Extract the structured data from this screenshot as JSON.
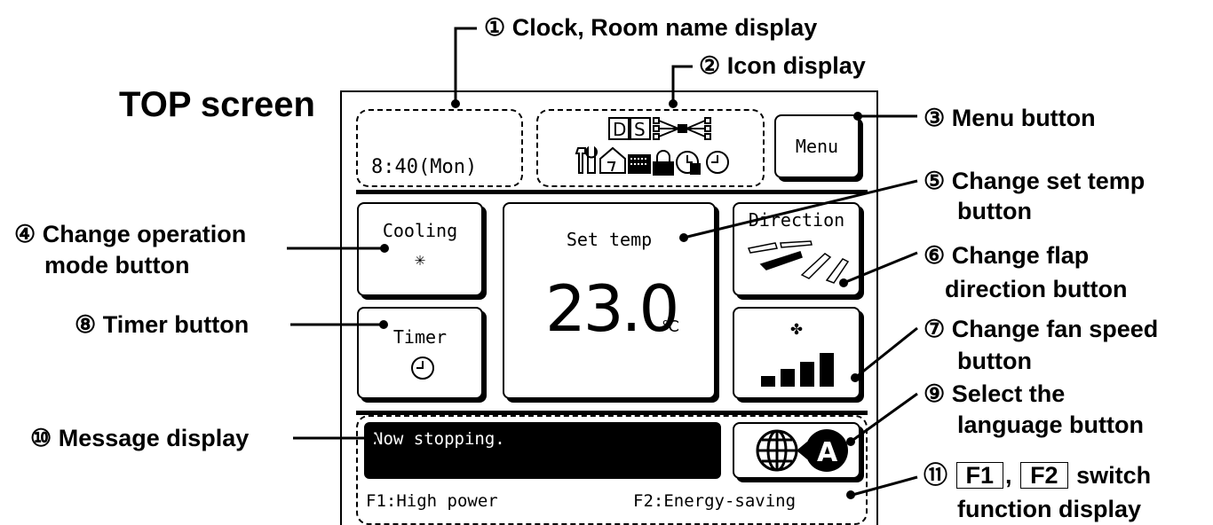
{
  "title": "TOP screen",
  "callouts": {
    "c1": "① Clock, Room name display",
    "c2": "② Icon display",
    "c3": "③ Menu button",
    "c4_l1": "④ Change operation",
    "c4_l2": "mode button",
    "c5_l1": "⑤ Change set temp",
    "c5_l2": "button",
    "c6_l1": "⑥ Change flap",
    "c6_l2": "direction button",
    "c7_l1": "⑦ Change fan speed",
    "c7_l2": "button",
    "c8": "⑧ Timer button",
    "c9_l1": "⑨ Select the",
    "c9_l2": "language button",
    "c10": "⑩ Message display",
    "c11_num": "⑪",
    "c11_f1": "F1",
    "c11_comma": ",",
    "c11_f2": "F2",
    "c11_rest": "switch",
    "c11_l2": "function display"
  },
  "screen": {
    "clock": "8:40(Mon)",
    "menu": "Menu",
    "mode_label": "Cooling",
    "mode_icon": "✳",
    "set_temp_label": "Set temp",
    "set_temp_value": "23.0",
    "unit": "℃",
    "direction_label": "Direction",
    "fan_icon": "fan-icon",
    "timer_label": "Timer",
    "message": "Now stopping.",
    "f1": "F1:High power",
    "f2": "F2:Energy-saving"
  },
  "icons": [
    "D-icon",
    "S-icon",
    "network-icon",
    "service-icon",
    "home-icon",
    "filter-icon",
    "lock-icon",
    "peak-cut-timer-icon",
    "clock-icon"
  ]
}
